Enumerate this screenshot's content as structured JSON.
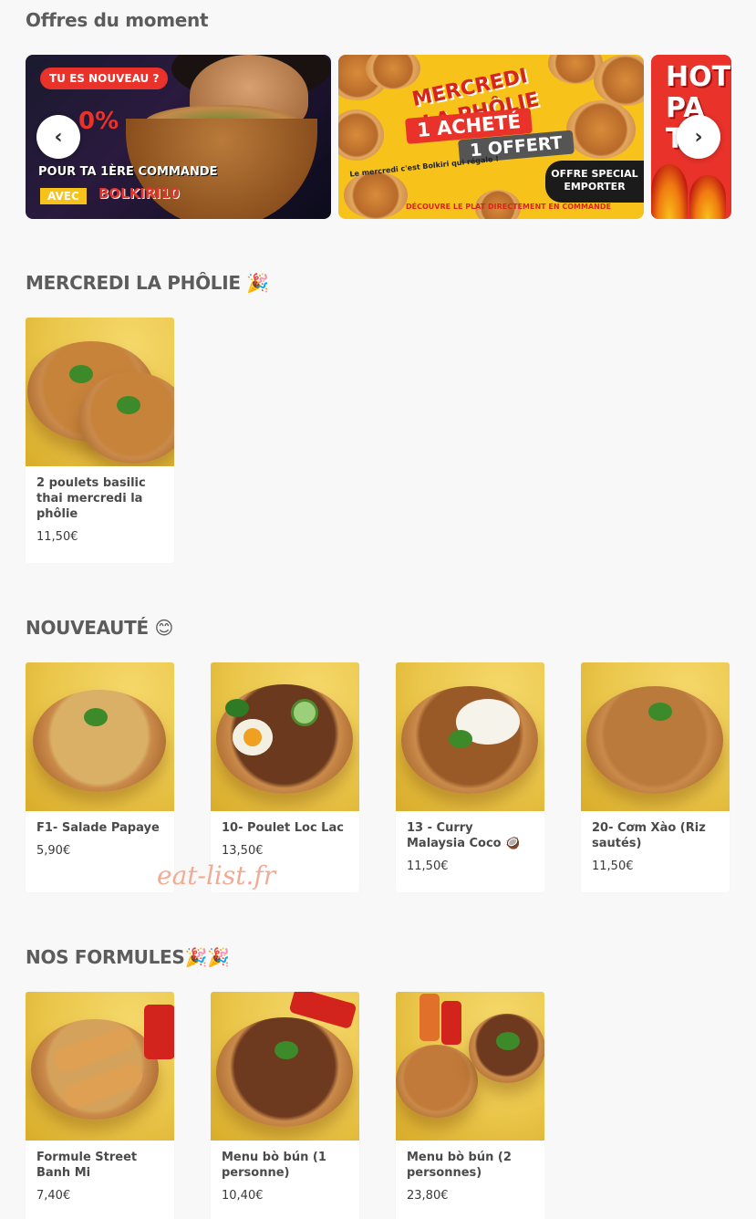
{
  "offers": {
    "title": "Offres du moment",
    "banner1": {
      "badge": "TU ES NOUVEAU ?",
      "percent": "0%",
      "line": "POUR TA 1ÈRE COMMANDE",
      "avec": "AVEC",
      "code": "BOLKIRI10"
    },
    "banner2": {
      "title_line1": "MERCREDI",
      "title_line2": "LA PHÔLIE",
      "achete": "1 ACHETÉ",
      "offert": "1 OFFERT",
      "tagline": "Le mercredi c'est Bolkiri qui régale !",
      "special_line1": "OFFRE SPECIAL",
      "special_line2": "EMPORTER",
      "footer": "DÉCOUVRE LE PLAT DIRECTEMENT EN COMMANDE"
    },
    "banner3": {
      "text": "HOT\nPA\nTH"
    },
    "prev_icon": "chevron-left-icon",
    "next_icon": "chevron-right-icon"
  },
  "sections": [
    {
      "title": "MERCREDI LA PHÔLIE 🎉",
      "items": [
        {
          "name": "2 poulets basilic thai mercredi la phôlie",
          "price": "11,50€",
          "food": "#c7833a"
        }
      ]
    },
    {
      "title": "NOUVEAUTÉ 😊",
      "items": [
        {
          "name": "F1- Salade Papaye",
          "price": "5,90€",
          "food": "#d9b066"
        },
        {
          "name": "10- Poulet Loc Lac",
          "price": "13,50€",
          "food": "#6b3a1e"
        },
        {
          "name": "13 - Curry Malaysia Coco 🥥",
          "price": "11,50€",
          "food": "#9a5a28"
        },
        {
          "name": "20- Cơm Xào (Riz sautés)",
          "price": "11,50€",
          "food": "#b97a3c"
        }
      ]
    },
    {
      "title": "NOS FORMULES🎉🎉",
      "items": [
        {
          "name": "Formule Street Banh Mi",
          "price": "7,40€",
          "food": "#d4a25a"
        },
        {
          "name": "Menu bò bún (1 personne)",
          "price": "10,40€",
          "food": "#6e3a1f"
        },
        {
          "name": "Menu bò bún (2 personnes)",
          "price": "23,80€",
          "food": "#c27a3a"
        }
      ]
    }
  ],
  "watermark": "eat-list.fr"
}
